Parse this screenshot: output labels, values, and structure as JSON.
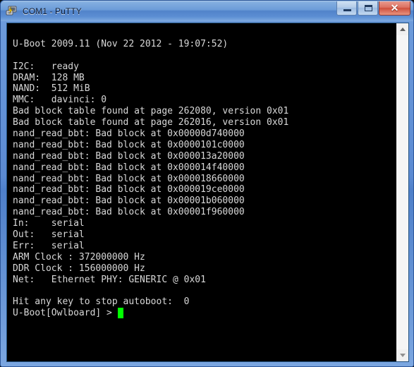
{
  "window": {
    "title": "COM1 - PuTTY",
    "icon": "putty-terminal-icon",
    "controls": {
      "minimize_label": "–",
      "maximize_label": "□",
      "close_label": "✕"
    },
    "colors": {
      "title_bar_blue": "#5b8ad2",
      "frame_border": "#2c5699",
      "close_button_red": "#cf4f3c",
      "terminal_background": "#000000",
      "terminal_foreground": "#d8d8d8",
      "cursor_green": "#00ff00",
      "scrollbar_track": "#f0f0f0"
    }
  },
  "scrollbar": {
    "up_arrow": "scroll-up-arrow",
    "down_arrow": "scroll-down-arrow"
  },
  "terminal": {
    "lines": [
      "",
      "U-Boot 2009.11 (Nov 22 2012 - 19:07:52)",
      "",
      "I2C:   ready",
      "DRAM:  128 MB",
      "NAND:  512 MiB",
      "MMC:   davinci: 0",
      "Bad block table found at page 262080, version 0x01",
      "Bad block table found at page 262016, version 0x01",
      "nand_read_bbt: Bad block at 0x00000d740000",
      "nand_read_bbt: Bad block at 0x0000101c0000",
      "nand_read_bbt: Bad block at 0x000013a20000",
      "nand_read_bbt: Bad block at 0x000014f40000",
      "nand_read_bbt: Bad block at 0x000018660000",
      "nand_read_bbt: Bad block at 0x000019ce0000",
      "nand_read_bbt: Bad block at 0x00001b060000",
      "nand_read_bbt: Bad block at 0x00001f960000",
      "In:    serial",
      "Out:   serial",
      "Err:   serial",
      "ARM Clock : 372000000 Hz",
      "DDR Clock : 156000000 Hz",
      "Net:   Ethernet PHY: GENERIC @ 0x01",
      "",
      "Hit any key to stop autoboot:  0"
    ],
    "prompt": "U-Boot[Owlboard] > ",
    "cursor": "block"
  }
}
